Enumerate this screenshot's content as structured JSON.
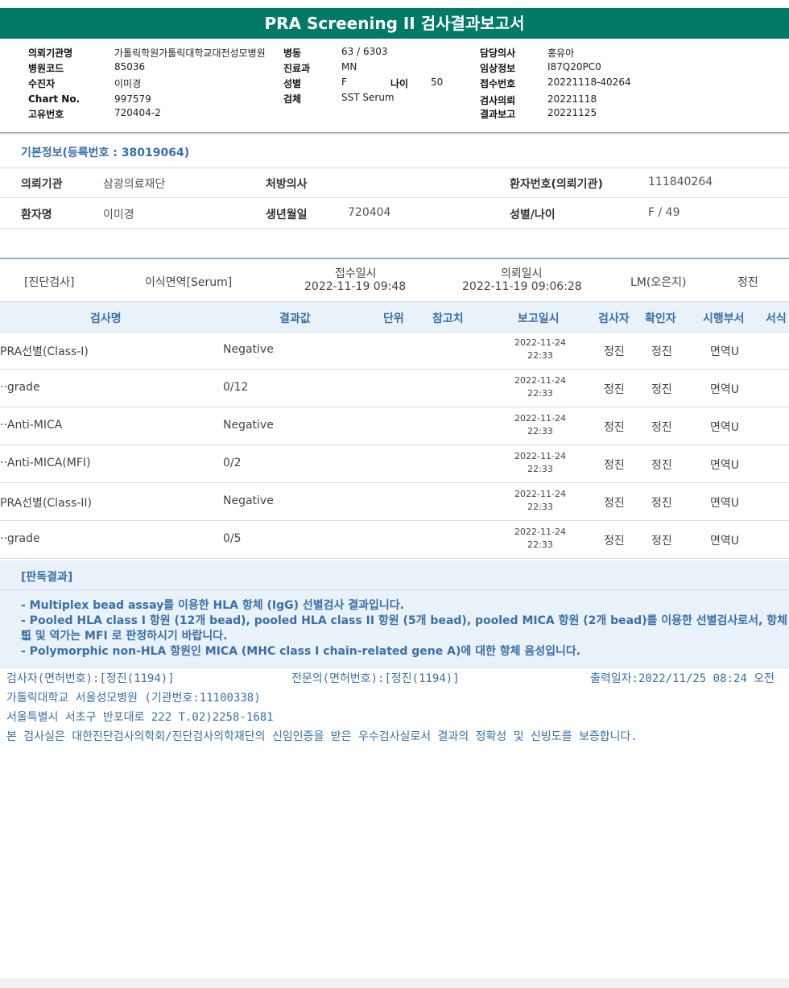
{
  "report_title": "PRA Screening II 검사결과보고서",
  "header": {
    "requesting_institution_label": "의뢰기관명",
    "requesting_institution": "가톨릭학원가톨릭대학교대전성모병원",
    "hospital_code_label": "병원코드",
    "hospital_code": "85036",
    "examinee_label": "수진자",
    "examinee": "이미경",
    "chart_no_label": "Chart No.",
    "chart_no": "997579",
    "unique_no_label": "고유번호",
    "unique_no": "720404-2",
    "ward_label": "병동",
    "ward": "63 / 6303",
    "department_label": "진료과",
    "department": "MN",
    "sex_label": "성별",
    "sex": "F",
    "age_label": "나이",
    "age": "50",
    "specimen_label": "검체",
    "specimen": "SST Serum",
    "doctor_label": "담당의사",
    "doctor": "홍유아",
    "clinical_info_label": "임상정보",
    "clinical_info": "I87Q20PC0",
    "receipt_no_label": "접수번호",
    "receipt_no": "20221118-40264",
    "test_request_label": "검사의뢰",
    "test_request": "20221118",
    "result_report_label": "결과보고",
    "result_report": "20221125"
  },
  "basic_info": {
    "title": "기본정보(등록번호 : 38019064)",
    "institution_label": "의뢰기관",
    "institution": "삼광의료재단",
    "prescriber_label": "처방의사",
    "prescriber": "",
    "patient_no_label": "환자번호(의뢰기관)",
    "patient_no": "111840264",
    "patient_name_label": "환자명",
    "patient_name": "이미경",
    "birth_label": "생년월일",
    "birth": "720404",
    "sex_age_label": "성별/나이",
    "sex_age": "F / 49"
  },
  "test_header": {
    "category": "[진단검사]",
    "test_type": "이식면역[Serum]",
    "received_label": "접수일시",
    "received": "2022-11-19 09:48",
    "requested_label": "의뢰일시",
    "requested": "2022-11-19 09:06:28",
    "lm": "LM(오은지)",
    "reviewer": "정진"
  },
  "columns": [
    "검사명",
    "결과값",
    "단위",
    "참고치",
    "보고일시",
    "검사자",
    "확인자",
    "시행부서",
    "서식"
  ],
  "rows": [
    {
      "name": "PRA선별(Class-I)",
      "result": "Negative",
      "unit": "",
      "ref": "",
      "date": "2022-11-24",
      "time": "22:33",
      "tester": "정진",
      "confirmer": "정진",
      "dept": "면역U"
    },
    {
      "name": "··grade",
      "result": "0/12",
      "unit": "",
      "ref": "",
      "date": "2022-11-24",
      "time": "22:33",
      "tester": "정진",
      "confirmer": "정진",
      "dept": "면역U"
    },
    {
      "name": "··Anti-MICA",
      "result": "Negative",
      "unit": "",
      "ref": "",
      "date": "2022-11-24",
      "time": "22:33",
      "tester": "정진",
      "confirmer": "정진",
      "dept": "면역U"
    },
    {
      "name": "··Anti-MICA(MFI)",
      "result": "0/2",
      "unit": "",
      "ref": "",
      "date": "2022-11-24",
      "time": "22:33",
      "tester": "정진",
      "confirmer": "정진",
      "dept": "면역U"
    },
    {
      "name": "PRA선별(Class-II)",
      "result": "Negative",
      "unit": "",
      "ref": "",
      "date": "2022-11-24",
      "time": "22:33",
      "tester": "정진",
      "confirmer": "정진",
      "dept": "면역U"
    },
    {
      "name": "··grade",
      "result": "0/5",
      "unit": "",
      "ref": "",
      "date": "2022-11-24",
      "time": "22:33",
      "tester": "정진",
      "confirmer": "정진",
      "dept": "면역U"
    }
  ],
  "interpretation": {
    "title": "[판독결과]",
    "lines": [
      "- Multiplex bead assay를 이용한 HLA 항체 (IgG) 선별검사 결과입니다.",
      "- Pooled HLA class I 항원 (12개 bead), pooled HLA class II 항원 (5개 bead), pooled MICA 항원 (2개 bead)를 이용한 선별검사로서, 항체빈",
      "도 및 역가는 MFI 로 판정하시기 바랍니다.",
      "- Polymorphic non-HLA 항원인 MICA (MHC class I chain-related gene A)에 대한 항체 음성입니다."
    ]
  },
  "footer": {
    "tester": "검사자(면허번호):[정진(1194)]",
    "specialist": "전문의(면허번호):[정진(1194)]",
    "printed": "출력일자:2022/11/25 08:24 오전",
    "hospital": "가톨릭대학교 서울성모병원 (기관번호:11100338)",
    "address": "서울특별시 서초구 반포대로 222 T.02)2258-1681",
    "certification": "본 검사실은 대한진단검사의학회/진단검사의학재단의 신임인증을 받은 우수검사실로서 결과의 정확성 및 신빙도를 보증합니다."
  }
}
